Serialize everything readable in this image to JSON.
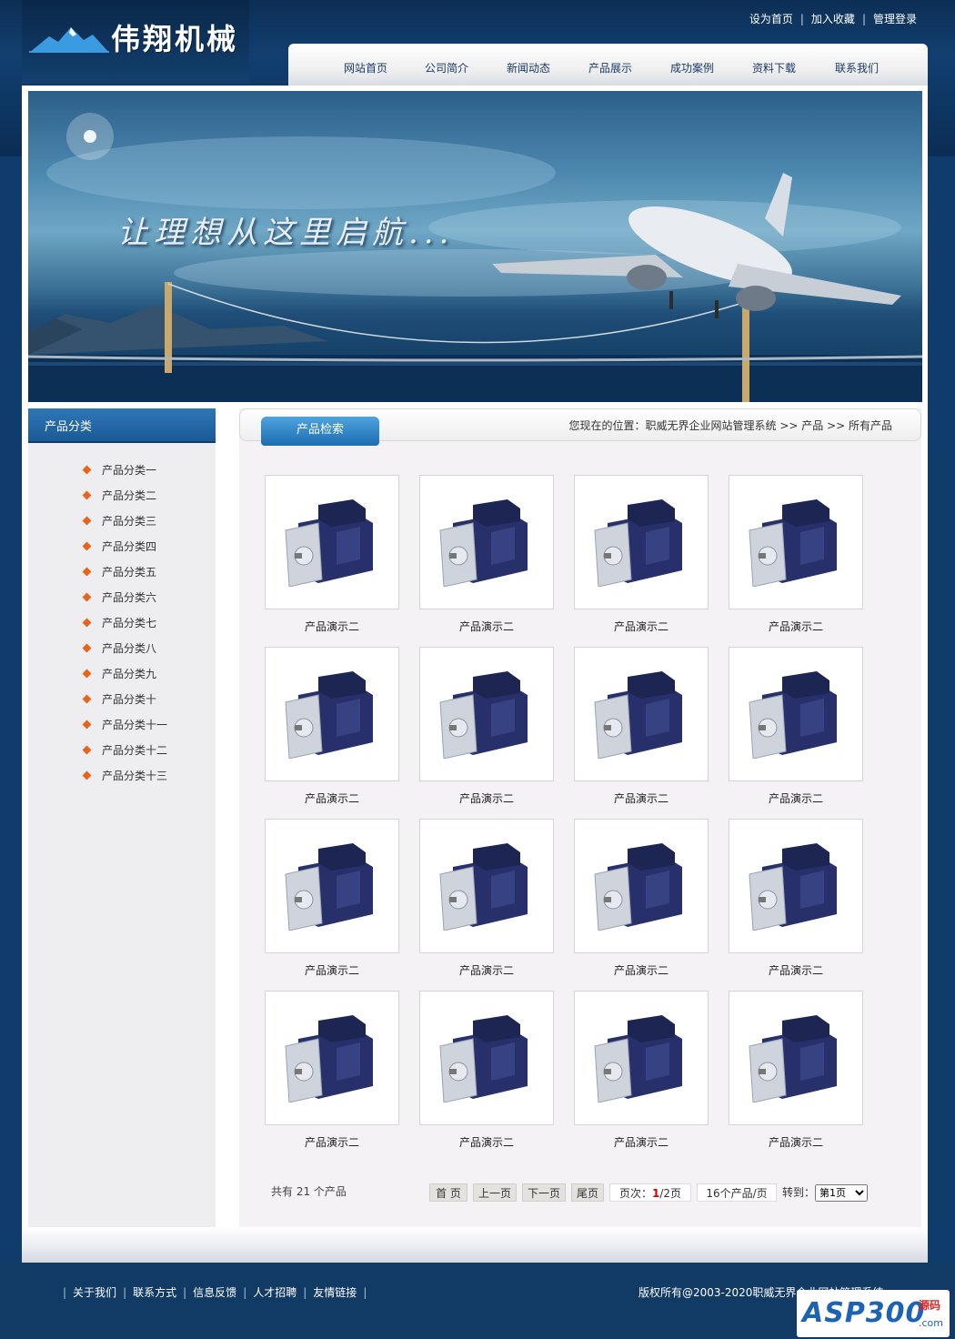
{
  "site": {
    "logo_text": "伟翔机械"
  },
  "top_links": [
    "设为首页",
    "加入收藏",
    "管理登录"
  ],
  "nav": [
    "网站首页",
    "公司简介",
    "新闻动态",
    "产品展示",
    "成功案例",
    "资料下载",
    "联系我们"
  ],
  "banner": {
    "slogan": "让理想从这里启航..."
  },
  "sidebar": {
    "title": "产品分类",
    "categories": [
      "产品分类一",
      "产品分类二",
      "产品分类三",
      "产品分类四",
      "产品分类五",
      "产品分类六",
      "产品分类七",
      "产品分类八",
      "产品分类九",
      "产品分类十",
      "产品分类十一",
      "产品分类十二",
      "产品分类十三"
    ]
  },
  "content": {
    "tab_label": "产品检索",
    "breadcrumb": "您现在的位置：职威无界企业网站管理系统 >> 产品 >> 所有产品",
    "products": [
      "产品演示二",
      "产品演示二",
      "产品演示二",
      "产品演示二",
      "产品演示二",
      "产品演示二",
      "产品演示二",
      "产品演示二",
      "产品演示二",
      "产品演示二",
      "产品演示二",
      "产品演示二",
      "产品演示二",
      "产品演示二",
      "产品演示二",
      "产品演示二"
    ],
    "total_text": "共有 21 个产品"
  },
  "pager": {
    "first": "首 页",
    "prev": "上一页",
    "next": "下一页",
    "last": "尾页",
    "page_prefix": "页次：",
    "current": "1",
    "total_pages": "/2页",
    "per_page": "16个产品/页",
    "jump_label": "转到：",
    "jump_selected": "第1页"
  },
  "footer": {
    "links": [
      "关于我们",
      "联系方式",
      "信息反馈",
      "人才招聘",
      "友情链接"
    ],
    "copyright": "版权所有@2003-2020职威无界企业网站管理系统"
  },
  "watermark": {
    "brand": "ASP300",
    "tag": "源码",
    "domain": ".com"
  },
  "colors": {
    "page_bg": "#0f3b6a",
    "accent": "#1c6db1",
    "bullet": "#e8641b",
    "current_page": "#cc0000"
  },
  "icons": [
    "mountain-logo-icon",
    "diamond-bullet-icon",
    "motor-product-image"
  ]
}
